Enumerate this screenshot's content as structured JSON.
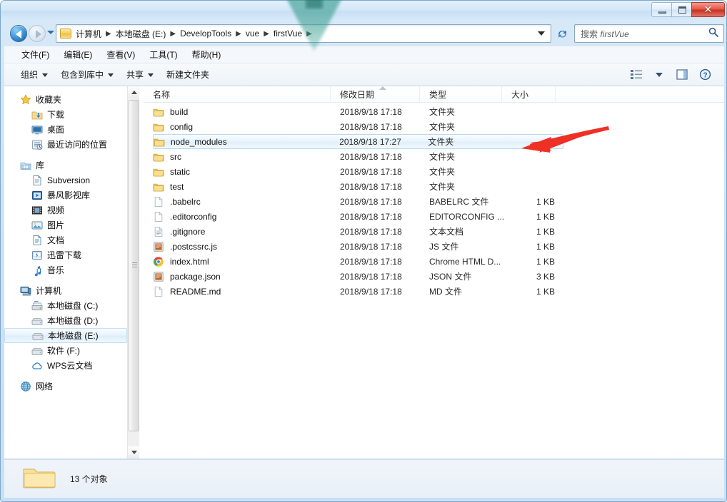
{
  "window": {
    "title": "",
    "controls": {
      "minimize": "minimize",
      "maximize": "maximize",
      "close": "✕"
    }
  },
  "address": {
    "crumbs": [
      "计算机",
      "本地磁盘 (E:)",
      "DevelopTools",
      "vue",
      "firstVue"
    ],
    "separator": "▶",
    "folder_icon": "folder-icon"
  },
  "search": {
    "placeholder_prefix": "搜索 ",
    "placeholder_term": "firstVue",
    "icon": "search-icon"
  },
  "menubar": {
    "items": [
      {
        "label": "文件(F)"
      },
      {
        "label": "编辑(E)"
      },
      {
        "label": "查看(V)"
      },
      {
        "label": "工具(T)"
      },
      {
        "label": "帮助(H)"
      }
    ]
  },
  "toolbar": {
    "items": [
      {
        "label": "组织",
        "has_caret": true
      },
      {
        "label": "包含到库中",
        "has_caret": true
      },
      {
        "label": "共享",
        "has_caret": true
      },
      {
        "label": "新建文件夹",
        "has_caret": false
      }
    ],
    "right_icons": [
      {
        "name": "view-list-icon"
      },
      {
        "name": "chevron-down-icon"
      },
      {
        "name": "preview-pane-icon"
      },
      {
        "name": "help-icon"
      }
    ]
  },
  "sidebar": {
    "groups": [
      {
        "header": {
          "label": "收藏夹",
          "icon": "star-icon"
        },
        "items": [
          {
            "label": "下载",
            "icon": "download-folder-icon"
          },
          {
            "label": "桌面",
            "icon": "desktop-icon"
          },
          {
            "label": "最近访问的位置",
            "icon": "recent-places-icon"
          }
        ]
      },
      {
        "header": {
          "label": "库",
          "icon": "library-icon"
        },
        "items": [
          {
            "label": "Subversion",
            "icon": "subversion-icon"
          },
          {
            "label": "暴风影视库",
            "icon": "baofeng-icon"
          },
          {
            "label": "视频",
            "icon": "video-icon"
          },
          {
            "label": "图片",
            "icon": "pictures-icon"
          },
          {
            "label": "文档",
            "icon": "documents-icon"
          },
          {
            "label": "迅雷下载",
            "icon": "thunder-download-icon"
          },
          {
            "label": "音乐",
            "icon": "music-icon"
          }
        ]
      },
      {
        "header": {
          "label": "计算机",
          "icon": "computer-icon"
        },
        "items": [
          {
            "label": "本地磁盘 (C:)",
            "icon": "system-drive-icon",
            "selected": false
          },
          {
            "label": "本地磁盘 (D:)",
            "icon": "drive-icon",
            "selected": false
          },
          {
            "label": "本地磁盘 (E:)",
            "icon": "drive-icon",
            "selected": true
          },
          {
            "label": "软件 (F:)",
            "icon": "drive-icon",
            "selected": false
          },
          {
            "label": "WPS云文档",
            "icon": "cloud-icon",
            "selected": false
          }
        ]
      },
      {
        "header": {
          "label": "网络",
          "icon": "network-icon"
        },
        "items": []
      }
    ],
    "scrollbar": {
      "up": "caret-up-icon",
      "down": "caret-down-icon"
    }
  },
  "filelist": {
    "columns": [
      {
        "key": "name",
        "label": "名称"
      },
      {
        "key": "date",
        "label": "修改日期"
      },
      {
        "key": "type",
        "label": "类型"
      },
      {
        "key": "size",
        "label": "大小"
      }
    ],
    "rows": [
      {
        "name": "build",
        "date": "2018/9/18 17:18",
        "type": "文件夹",
        "size": "",
        "icon": "folder-icon",
        "active": false
      },
      {
        "name": "config",
        "date": "2018/9/18 17:18",
        "type": "文件夹",
        "size": "",
        "icon": "folder-icon",
        "active": false
      },
      {
        "name": "node_modules",
        "date": "2018/9/18 17:27",
        "type": "文件夹",
        "size": "",
        "icon": "folder-icon",
        "active": true
      },
      {
        "name": "src",
        "date": "2018/9/18 17:18",
        "type": "文件夹",
        "size": "",
        "icon": "folder-icon",
        "active": false
      },
      {
        "name": "static",
        "date": "2018/9/18 17:18",
        "type": "文件夹",
        "size": "",
        "icon": "folder-icon",
        "active": false
      },
      {
        "name": "test",
        "date": "2018/9/18 17:18",
        "type": "文件夹",
        "size": "",
        "icon": "folder-icon",
        "active": false
      },
      {
        "name": ".babelrc",
        "date": "2018/9/18 17:18",
        "type": "BABELRC 文件",
        "size": "1 KB",
        "icon": "blank-file-icon",
        "active": false
      },
      {
        "name": ".editorconfig",
        "date": "2018/9/18 17:18",
        "type": "EDITORCONFIG ...",
        "size": "1 KB",
        "icon": "blank-file-icon",
        "active": false
      },
      {
        "name": ".gitignore",
        "date": "2018/9/18 17:18",
        "type": "文本文档",
        "size": "1 KB",
        "icon": "text-file-icon",
        "active": false
      },
      {
        "name": ".postcssrc.js",
        "date": "2018/9/18 17:18",
        "type": "JS 文件",
        "size": "1 KB",
        "icon": "js-file-icon",
        "active": false
      },
      {
        "name": "index.html",
        "date": "2018/9/18 17:18",
        "type": "Chrome HTML D...",
        "size": "1 KB",
        "icon": "chrome-icon",
        "active": false
      },
      {
        "name": "package.json",
        "date": "2018/9/18 17:18",
        "type": "JSON 文件",
        "size": "3 KB",
        "icon": "js-file-icon",
        "active": false
      },
      {
        "name": "README.md",
        "date": "2018/9/18 17:18",
        "type": "MD 文件",
        "size": "1 KB",
        "icon": "blank-file-icon",
        "active": false
      }
    ]
  },
  "statusbar": {
    "icon": "folder-large-icon",
    "text": "13 个对象"
  },
  "annotation": {
    "arrow": {
      "name": "red-arrow-pointer",
      "color": "#ee3124"
    },
    "watermark": {
      "name": "teal-triangle-watermark",
      "color": "#3e9e91"
    }
  },
  "colors": {
    "accent": "#3a8fd4",
    "selection": "#e1effb",
    "frame": "#cfe3f5",
    "close_button": "#c9301e"
  }
}
